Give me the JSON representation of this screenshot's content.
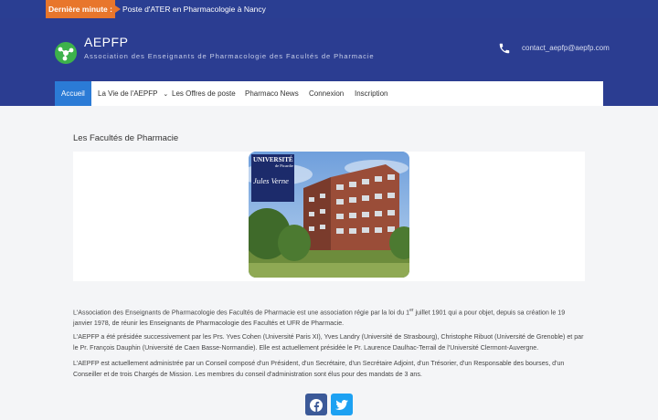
{
  "ticker": {
    "label": "Dernière minute :",
    "news": "Poste d'ATER en Pharmacologie à Nancy"
  },
  "header": {
    "title": "AEPFP",
    "description": "Association des Enseignants de Pharmacologie des Facultés de Pharmacie",
    "contact": "contact_aepfp@aepfp.com"
  },
  "nav": {
    "items": [
      {
        "label": "Accueil"
      },
      {
        "label": "La Vie de l'AEPFP"
      },
      {
        "label": "Les Offres de poste"
      },
      {
        "label": "Pharmaco News"
      },
      {
        "label": "Connexion"
      },
      {
        "label": "Inscription"
      }
    ]
  },
  "page": {
    "title": "Les Facultés de Pharmacie",
    "logo_text": [
      "UNIVERSITÉ",
      "de Picardie",
      "Jules Verne"
    ],
    "p1_a": "L'Association des Enseignants de Pharmacologie des Facultés de Pharmacie est une association régie par la loi du 1",
    "p1_sup": "er",
    "p1_b": " juillet 1901 qui a pour objet, depuis sa création le 19 janvier 1978, de réunir les Enseignants de Pharmacologie des Facultés et UFR de Pharmacie.",
    "p2": "L'AEPFP a été présidée successivement par les Prs. Yves Cohen (Université Paris XI), Yves Landry (Université de Strasbourg), Christophe Ribuot (Université de Grenoble) et par le Pr. François Dauphin (Université de Caen Basse-Normandie). Elle est actuellement présidée le Pr. Laurence Daulhac-Terrail de l'Université Clermont-Auvergne.",
    "p3": "L'AEPFP est actuellement administrée par un Conseil composé d'un Président, d'un Secrétaire, d'un Secrétaire Adjoint, d'un Trésorier, d'un Responsable des bourses, d'un Conseiller et de trois Chargés de Mission. Les membres du conseil d'administration sont élus pour des mandats de 3 ans."
  },
  "colors": {
    "header": "#2b3d91",
    "accent": "#e8762c",
    "active": "#2b7bd6",
    "facebook": "#3b5998",
    "twitter": "#1da1f2"
  },
  "icons": [
    "molecule-logo-icon",
    "phone-icon",
    "chevron-down-icon",
    "facebook-icon",
    "twitter-icon"
  ]
}
